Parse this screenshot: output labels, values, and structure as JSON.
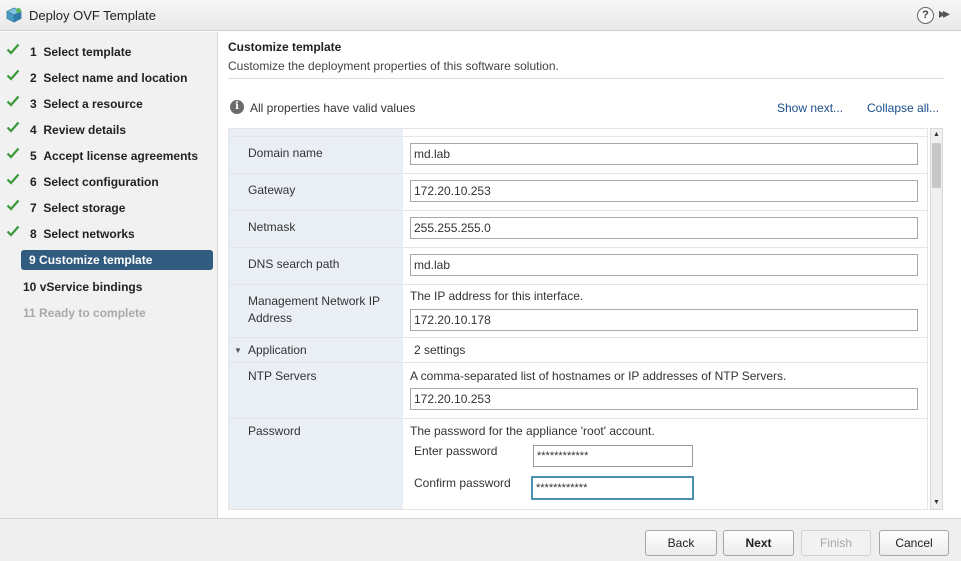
{
  "window": {
    "title": "Deploy OVF Template",
    "help_icon": "?",
    "expand_icon": "▸▸"
  },
  "steps": [
    {
      "num": "1",
      "label": "Select template",
      "state": "done"
    },
    {
      "num": "2",
      "label": "Select name and location",
      "state": "done"
    },
    {
      "num": "3",
      "label": "Select a resource",
      "state": "done"
    },
    {
      "num": "4",
      "label": "Review details",
      "state": "done"
    },
    {
      "num": "5",
      "label": "Accept license agreements",
      "state": "done"
    },
    {
      "num": "6",
      "label": "Select configuration",
      "state": "done"
    },
    {
      "num": "7",
      "label": "Select storage",
      "state": "done"
    },
    {
      "num": "8",
      "label": "Select networks",
      "state": "done"
    },
    {
      "num": "9",
      "label": "Customize template",
      "state": "active"
    },
    {
      "num": "10",
      "label": "vService bindings",
      "state": "pending"
    },
    {
      "num": "11",
      "label": "Ready to complete",
      "state": "disabled"
    }
  ],
  "main": {
    "title": "Customize template",
    "subtitle": "Customize the deployment properties of this software solution.",
    "info_text": "All properties have valid values",
    "show_next": "Show next...",
    "collapse_all": "Collapse all..."
  },
  "properties": {
    "domain_name": {
      "label": "Domain name",
      "value": "md.lab"
    },
    "gateway": {
      "label": "Gateway",
      "value": "172.20.10.253"
    },
    "netmask": {
      "label": "Netmask",
      "value": "255.255.255.0"
    },
    "dns_search": {
      "label": "DNS search path",
      "value": "md.lab"
    },
    "mgmt_ip": {
      "label": "Management Network IP Address",
      "desc": "The IP address for this interface.",
      "value": "172.20.10.178"
    },
    "application": {
      "label": "Application",
      "count": "2 settings"
    },
    "ntp": {
      "label": "NTP Servers",
      "desc": "A comma-separated list of hostnames or IP addresses of NTP Servers.",
      "value": "172.20.10.253"
    },
    "password": {
      "label": "Password",
      "desc": "The password for the appliance 'root' account.",
      "enter_label": "Enter password",
      "enter_value": "************",
      "confirm_label": "Confirm password",
      "confirm_value": "************"
    }
  },
  "footer": {
    "back": "Back",
    "next": "Next",
    "finish": "Finish",
    "cancel": "Cancel"
  },
  "colors": {
    "active_step": "#325b80",
    "check": "#3a9a3a",
    "link": "#1a4e8a",
    "focus_border": "#4a8fb0"
  }
}
